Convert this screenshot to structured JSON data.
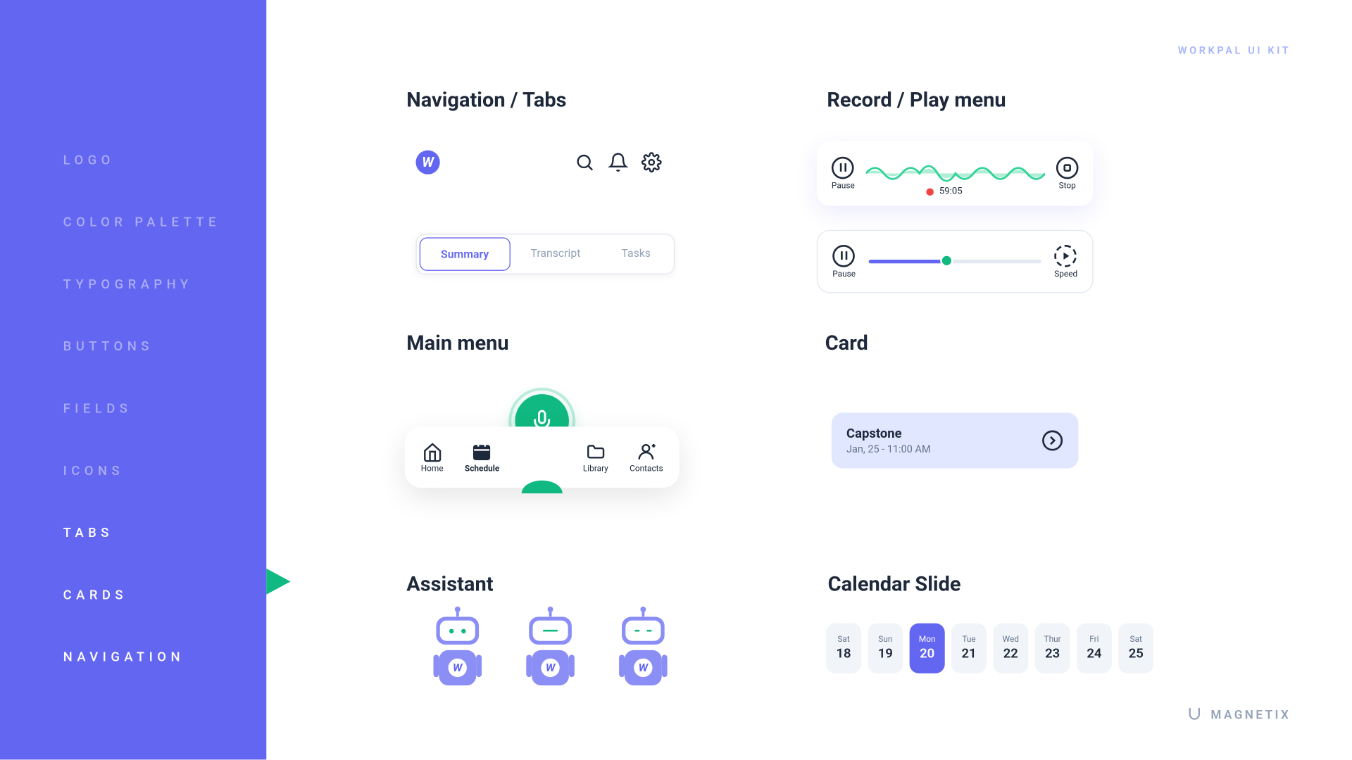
{
  "header": {
    "kit_label": "WORKPAL UI KIT"
  },
  "sidebar": {
    "items": [
      {
        "label": "LOGO"
      },
      {
        "label": "COLOR PALETTE"
      },
      {
        "label": "TYPOGRAPHY"
      },
      {
        "label": "BUTTONS"
      },
      {
        "label": "FIELDS"
      },
      {
        "label": "ICONS"
      },
      {
        "label": "TABS"
      },
      {
        "label": "CARDS"
      },
      {
        "label": "NAVIGATION"
      }
    ],
    "active_index": 6
  },
  "sections": {
    "nav_tabs": "Navigation / Tabs",
    "record": "Record / Play menu",
    "mainmenu": "Main menu",
    "card": "Card",
    "assistant": "Assistant",
    "calendar": "Calendar Slide"
  },
  "logo_letter": "W",
  "tabs": {
    "items": [
      {
        "label": "Summary"
      },
      {
        "label": "Transcript"
      },
      {
        "label": "Tasks"
      }
    ],
    "active_index": 0
  },
  "record": {
    "pause_label": "Pause",
    "stop_label": "Stop",
    "time": "59:05"
  },
  "play": {
    "pause_label": "Pause",
    "speed_label": "Speed",
    "progress_pct": 45
  },
  "mainmenu": {
    "items": [
      {
        "label": "Home"
      },
      {
        "label": "Schedule"
      },
      {
        "label": "Library"
      },
      {
        "label": "Contacts"
      }
    ],
    "active_index": 1
  },
  "card": {
    "title": "Capstone",
    "subtitle": "Jan, 25 - 11:00 AM"
  },
  "calendar": {
    "days": [
      {
        "dow": "Sat",
        "num": "18"
      },
      {
        "dow": "Sun",
        "num": "19"
      },
      {
        "dow": "Mon",
        "num": "20"
      },
      {
        "dow": "Tue",
        "num": "21"
      },
      {
        "dow": "Wed",
        "num": "22"
      },
      {
        "dow": "Thur",
        "num": "23"
      },
      {
        "dow": "Fri",
        "num": "24"
      },
      {
        "dow": "Sat",
        "num": "25"
      }
    ],
    "active_index": 2
  },
  "brand": "MAGNETIX"
}
